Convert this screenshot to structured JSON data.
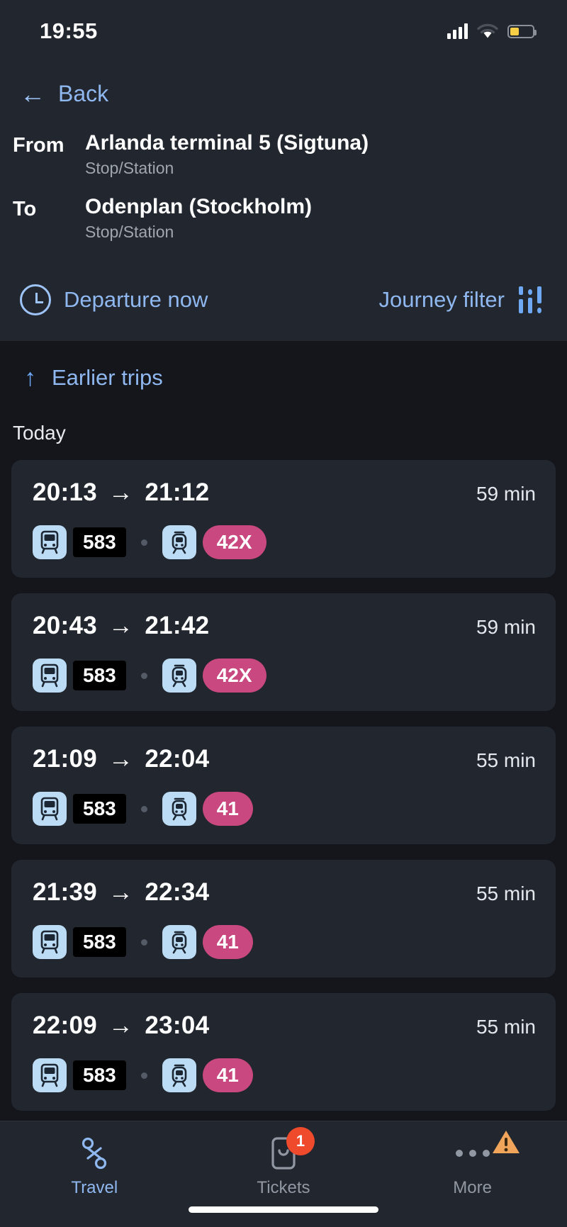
{
  "status_bar": {
    "time": "19:55",
    "signal_icon": "cellular-signal-icon",
    "wifi_icon": "wifi-icon",
    "battery_icon": "battery-low-icon"
  },
  "header": {
    "back_label": "Back",
    "back_icon": "arrow-left-icon",
    "from_key": "From",
    "from_value": "Arlanda terminal 5 (Sigtuna)",
    "from_sub": "Stop/Station",
    "to_key": "To",
    "to_value": "Odenplan (Stockholm)",
    "to_sub": "Stop/Station",
    "departure_label": "Departure now",
    "clock_icon": "clock-icon",
    "journey_filter_label": "Journey filter",
    "filter_icon": "sliders-filter-icon"
  },
  "results": {
    "earlier_label": "Earlier trips",
    "earlier_icon": "arrow-up-icon",
    "day_label": "Today",
    "arrow_glyph": "→",
    "trips": [
      {
        "depart": "20:13",
        "arrive": "21:12",
        "duration": "59 min",
        "legs": [
          {
            "mode": "bus",
            "mode_icon": "bus-icon",
            "line": "583",
            "style": "box"
          },
          {
            "mode": "train",
            "mode_icon": "train-icon",
            "line": "42X",
            "style": "pill"
          }
        ]
      },
      {
        "depart": "20:43",
        "arrive": "21:42",
        "duration": "59 min",
        "legs": [
          {
            "mode": "bus",
            "mode_icon": "bus-icon",
            "line": "583",
            "style": "box"
          },
          {
            "mode": "train",
            "mode_icon": "train-icon",
            "line": "42X",
            "style": "pill"
          }
        ]
      },
      {
        "depart": "21:09",
        "arrive": "22:04",
        "duration": "55 min",
        "legs": [
          {
            "mode": "bus",
            "mode_icon": "bus-icon",
            "line": "583",
            "style": "box"
          },
          {
            "mode": "train",
            "mode_icon": "train-icon",
            "line": "41",
            "style": "pill"
          }
        ]
      },
      {
        "depart": "21:39",
        "arrive": "22:34",
        "duration": "55 min",
        "legs": [
          {
            "mode": "bus",
            "mode_icon": "bus-icon",
            "line": "583",
            "style": "box"
          },
          {
            "mode": "train",
            "mode_icon": "train-icon",
            "line": "41",
            "style": "pill"
          }
        ]
      },
      {
        "depart": "22:09",
        "arrive": "23:04",
        "duration": "55 min",
        "legs": [
          {
            "mode": "bus",
            "mode_icon": "bus-icon",
            "line": "583",
            "style": "box"
          },
          {
            "mode": "train",
            "mode_icon": "train-icon",
            "line": "41",
            "style": "pill"
          }
        ]
      }
    ]
  },
  "tabbar": {
    "tabs": [
      {
        "label": "Travel",
        "icon": "route-icon",
        "active": true
      },
      {
        "label": "Tickets",
        "icon": "ticket-phone-icon",
        "active": false,
        "badge": "1"
      },
      {
        "label": "More",
        "icon": "more-dots-icon",
        "active": false,
        "warning_icon": "warning-triangle-icon"
      }
    ]
  },
  "colors": {
    "accent_blue": "#8fb8f0",
    "line_pink": "#c9487f",
    "mode_chip_blue": "#bcdcf5",
    "badge_red": "#ef4a2b",
    "warning_orange": "#f0a55a",
    "card_bg": "#22262e",
    "page_bg": "#14161b",
    "battery_yellow": "#f6cf46"
  }
}
